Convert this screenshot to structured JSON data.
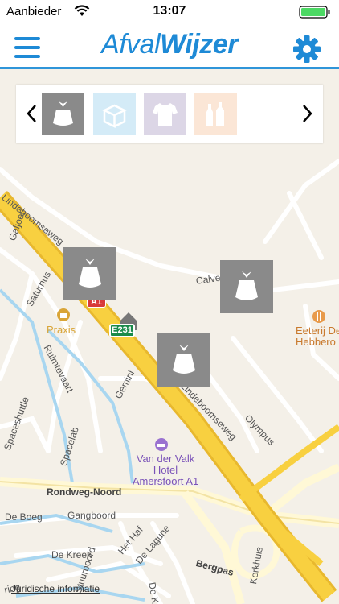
{
  "status_bar": {
    "carrier": "Aanbieder",
    "time": "13:07"
  },
  "header": {
    "logo_part1": "Afval",
    "logo_part2": "Wijzer"
  },
  "filters": {
    "items": [
      {
        "name": "restafval",
        "color": "#8a8a8a",
        "icon": "waste-bag-icon"
      },
      {
        "name": "papier",
        "color": "#d4ebf7",
        "icon": "paper-box-icon"
      },
      {
        "name": "textiel",
        "color": "#dcd6e6",
        "icon": "tshirt-icon"
      },
      {
        "name": "pmd",
        "color": "#fbe6d6",
        "icon": "bottles-icon"
      }
    ]
  },
  "map": {
    "street_labels": [
      "Lindeboomseweg",
      "Galjoet",
      "Saturnus",
      "Calve",
      "Ruimtevaart",
      "Gemini",
      "Lindeboomseweg",
      "Olympus",
      "Spaceshuttle",
      "Spacelab",
      "Rondweg-Noord",
      "De Boeg",
      "Gangboord",
      "Het Haf",
      "De Lagune",
      "De Kreek",
      "Bergpas",
      "Stuurboord",
      "De K",
      "ring",
      "Kerkhuis"
    ],
    "pois": [
      {
        "name": "Praxis",
        "color": "#d9a538"
      },
      {
        "name": "Eeterij De\nHebbero",
        "color": "#d98a38"
      },
      {
        "name": "Van der Valk\nHotel\nAmersfoort A1",
        "color": "#8a63c4"
      }
    ],
    "road_signs": [
      "A1",
      "E231"
    ],
    "legal_link": "Juridische informatie"
  },
  "markers": [
    {
      "type": "restafval",
      "icon": "waste-bag-icon"
    },
    {
      "type": "restafval",
      "icon": "waste-bag-icon"
    },
    {
      "type": "restafval",
      "icon": "waste-bag-icon"
    }
  ]
}
